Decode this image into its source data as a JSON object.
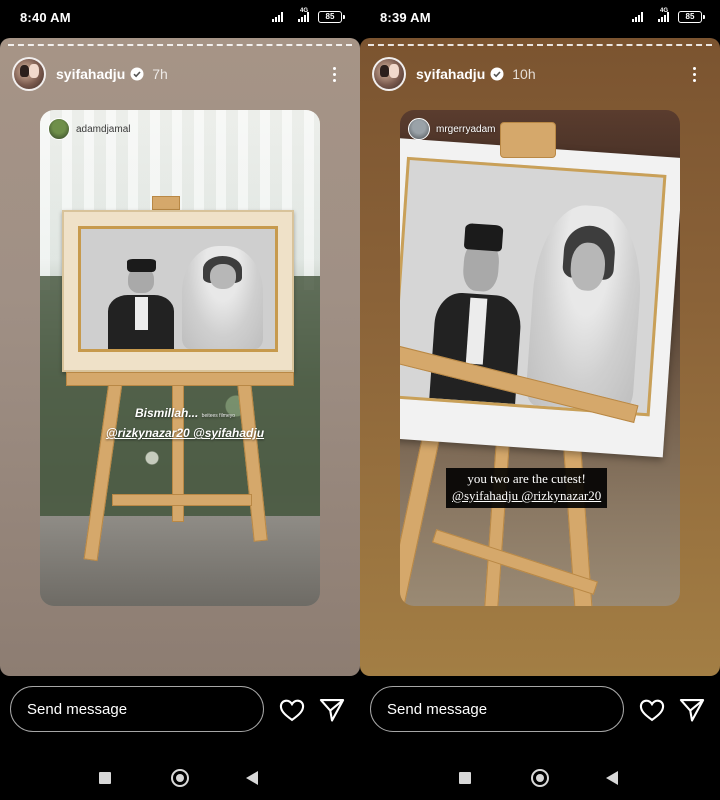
{
  "panes": [
    {
      "status": {
        "time": "8:40 AM",
        "network": "4G",
        "battery": "85"
      },
      "story": {
        "username": "syifahadju",
        "posted_ago": "7h",
        "repost_from": "adamdjamal",
        "caption_line1": "Bismillah...",
        "caption_small": "beitees filmeyo",
        "caption_line2": "@rizkynazar20 @syifahadju"
      },
      "reply": {
        "placeholder": "Send message"
      }
    },
    {
      "status": {
        "time": "8:39 AM",
        "network": "4G",
        "battery": "85"
      },
      "story": {
        "username": "syifahadju",
        "posted_ago": "10h",
        "repost_from": "mrgerryadam",
        "caption_line1": "you two are the cutest!",
        "caption_line2": "@syifahadju @rizkynazar20"
      },
      "reply": {
        "placeholder": "Send message"
      }
    }
  ],
  "icons": {
    "verified": "verified-badge-icon",
    "more": "more-options-icon",
    "like": "heart-icon",
    "send": "paper-plane-icon",
    "recents": "square-icon",
    "home": "circle-icon",
    "back": "triangle-back-icon"
  },
  "colors": {
    "verified_blue": "#3897f0",
    "reply_border": "#aaaaaa"
  }
}
